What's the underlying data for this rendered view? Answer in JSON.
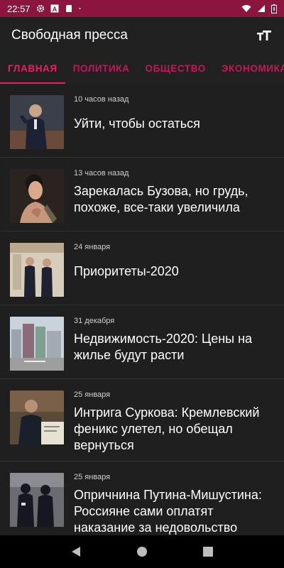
{
  "status_bar": {
    "time": "22:57",
    "icons": [
      "gear-icon",
      "font-a-icon",
      "sd-card-icon",
      "dot-icon",
      "wifi-icon",
      "signal-icon",
      "battery-icon"
    ]
  },
  "app_bar": {
    "title": "Свободная пресса",
    "action_icon": "text-size-icon"
  },
  "tabs": [
    {
      "label": "ГЛАВНАЯ",
      "active": true
    },
    {
      "label": "ПОЛИТИКА",
      "active": false
    },
    {
      "label": "ОБЩЕСТВО",
      "active": false
    },
    {
      "label": "ЭКОНОМИКА",
      "active": false
    }
  ],
  "articles": [
    {
      "time": "10 часов назад",
      "title": "Уйти, чтобы остаться"
    },
    {
      "time": "13 часов назад",
      "title": "Зарекалась Бузова, но грудь, похоже, все-таки увеличила"
    },
    {
      "time": "24 января",
      "title": "Приоритеты-2020"
    },
    {
      "time": "31 декабря",
      "title": "Недвижимость-2020: Цены на жилье будут расти"
    },
    {
      "time": "25 января",
      "title": "Интрига Суркова: Кремлевский феникс улетел, но обещал вернуться"
    },
    {
      "time": "25 января",
      "title": "Опричнина Путина-Мишустина: Россияне сами оплатят наказание за недовольство"
    }
  ],
  "colors": {
    "status_bar": "#8c1540",
    "accent": "#e91e63",
    "background": "#1f1f1f"
  },
  "nav_bar": {
    "icons": [
      "back-icon",
      "home-icon",
      "recents-icon"
    ]
  }
}
